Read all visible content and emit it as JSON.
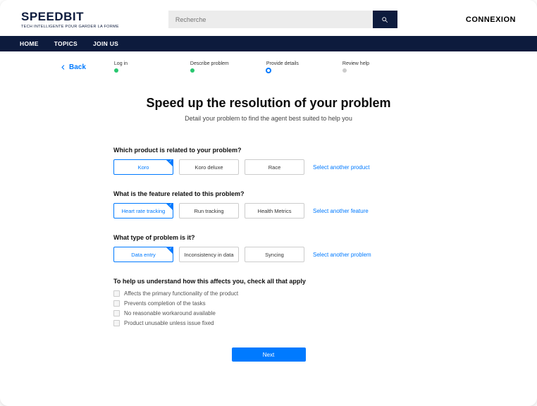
{
  "brand": {
    "name": "SPEEDBIT",
    "tagline": "TECH INTELLIGENTE POUR GARDER LA FORME"
  },
  "search": {
    "placeholder": "Recherche"
  },
  "header": {
    "connexion": "CONNEXION"
  },
  "nav": {
    "home": "HOME",
    "topics": "TOPICS",
    "join": "JOIN US"
  },
  "back": "Back",
  "steps": [
    {
      "label": "Log in",
      "state": "done"
    },
    {
      "label": "Describe problem",
      "state": "done"
    },
    {
      "label": "Provide details",
      "state": "active"
    },
    {
      "label": "Review help",
      "state": "todo"
    }
  ],
  "title": "Speed up the resolution of your problem",
  "subtitle": "Detail your problem to find the agent best suited to help you",
  "q1": {
    "label": "Which product is related to your problem?",
    "options": [
      "Koro",
      "Koro deluxe",
      "Race"
    ],
    "selected": 0,
    "link": "Select another product"
  },
  "q2": {
    "label": "What is the feature related to this problem?",
    "options": [
      "Heart rate tracking",
      "Run tracking",
      "Health Metrics"
    ],
    "selected": 0,
    "link": "Select another feature"
  },
  "q3": {
    "label": "What type of problem is it?",
    "options": [
      "Data entry",
      "Inconsistency in data",
      "Syncing"
    ],
    "selected": 0,
    "link": "Select another problem"
  },
  "q4": {
    "label": "To help us understand how this affects you, check all that apply",
    "checks": [
      "Affects the primary functionality of the product",
      "Prevents completion of the tasks",
      "No reasonable workaround available",
      "Product unusable unless issue fixed"
    ]
  },
  "next": "Next"
}
